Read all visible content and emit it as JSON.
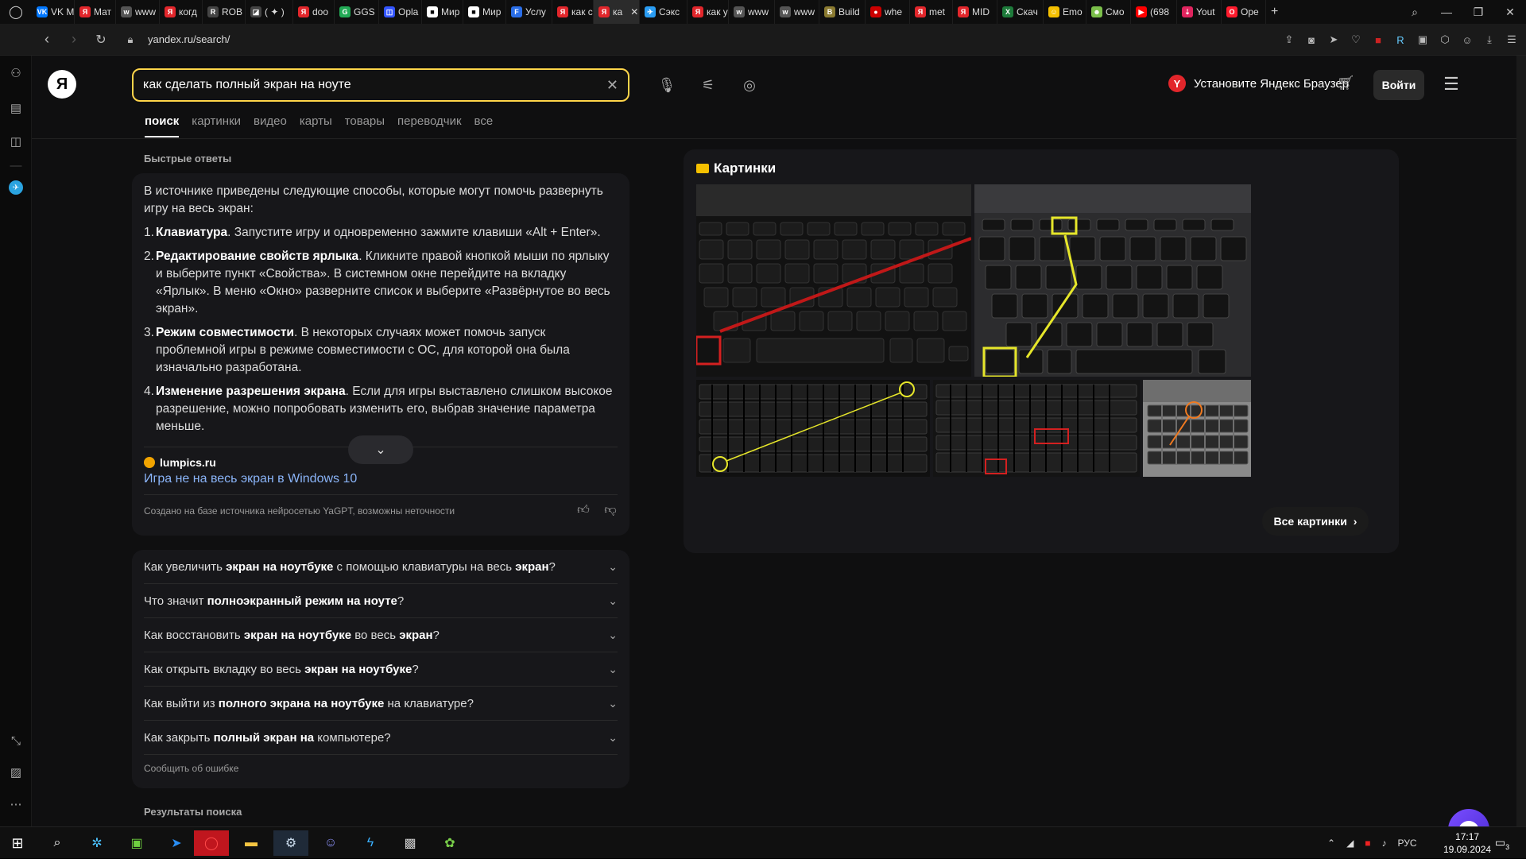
{
  "browser": {
    "tabs": [
      {
        "label": "VK M",
        "color": "#0077ff",
        "glyph": "VK"
      },
      {
        "label": "Мат",
        "color": "#e2262b",
        "glyph": "Я"
      },
      {
        "label": "www",
        "color": "#555555",
        "glyph": "w"
      },
      {
        "label": "когд",
        "color": "#e2262b",
        "glyph": "Я"
      },
      {
        "label": "ROB",
        "color": "#444444",
        "glyph": "R"
      },
      {
        "label": "( ✦ )",
        "color": "#444444",
        "glyph": "◪"
      },
      {
        "label": "doo",
        "color": "#e2262b",
        "glyph": "Я"
      },
      {
        "label": "GGS",
        "color": "#22aa55",
        "glyph": "G"
      },
      {
        "label": "Opla",
        "color": "#3355ff",
        "glyph": "◫"
      },
      {
        "label": "Мир",
        "color": "#ffffff",
        "glyph": "■"
      },
      {
        "label": "Мир",
        "color": "#ffffff",
        "glyph": "■"
      },
      {
        "label": "Услу",
        "color": "#2a6ee8",
        "glyph": "F"
      },
      {
        "label": "как с",
        "color": "#e2262b",
        "glyph": "Я"
      },
      {
        "label": "ка",
        "color": "#e2262b",
        "glyph": "Я",
        "active": true
      },
      {
        "label": "Сэкс",
        "color": "#2a9df4",
        "glyph": "✈"
      },
      {
        "label": "как у",
        "color": "#e2262b",
        "glyph": "Я"
      },
      {
        "label": "www",
        "color": "#555555",
        "glyph": "w"
      },
      {
        "label": "www",
        "color": "#555555",
        "glyph": "w"
      },
      {
        "label": "Build",
        "color": "#8a7a30",
        "glyph": "B"
      },
      {
        "label": "whe",
        "color": "#cc0000",
        "glyph": "●"
      },
      {
        "label": "met",
        "color": "#e2262b",
        "glyph": "Я"
      },
      {
        "label": "MID",
        "color": "#e2262b",
        "glyph": "Я"
      },
      {
        "label": "Скач",
        "color": "#1d7a3a",
        "glyph": "X"
      },
      {
        "label": "Emo",
        "color": "#f5c000",
        "glyph": "☺"
      },
      {
        "label": "Смо",
        "color": "#7bbf4a",
        "glyph": "☻"
      },
      {
        "label": "(698",
        "color": "#ff0000",
        "glyph": "▶"
      },
      {
        "label": "Yout",
        "color": "#e0245e",
        "glyph": "⇣"
      },
      {
        "label": "Ope",
        "color": "#ff1b2d",
        "glyph": "O"
      }
    ],
    "url": "yandex.ru/search/"
  },
  "header": {
    "logo": "Я",
    "search_value": "как сделать полный экран на ноуте",
    "install_badge": "Y",
    "install_label": "Установите Яндекс Браузер",
    "login_label": "Войти"
  },
  "services": [
    {
      "label": "поиск",
      "active": true
    },
    {
      "label": "картинки"
    },
    {
      "label": "видео"
    },
    {
      "label": "карты"
    },
    {
      "label": "товары"
    },
    {
      "label": "переводчик"
    },
    {
      "label": "все"
    }
  ],
  "quick_answers": {
    "title": "Быстрые ответы",
    "intro": "В источнике приведены следующие способы, которые могут помочь развернуть игру на весь экран:",
    "items": [
      {
        "n": "1.",
        "bold": "Клавиатура",
        "text": ". Запустите игру и одновременно зажмите клавиши «Alt + Enter»."
      },
      {
        "n": "2.",
        "bold": "Редактирование свойств ярлыка",
        "text": ". Кликните правой кнопкой мыши по ярлыку и выберите пункт «Свойства». В системном окне перейдите на вкладку «Ярлык». В меню «Окно» разверните список и выберите «Развёрнутое во весь экран»."
      },
      {
        "n": "3.",
        "bold": "Режим совместимости",
        "text": ". В некоторых случаях может помочь запуск проблемной игры в режиме совместимости с ОС, для которой она была изначально разработана."
      },
      {
        "n": "4.",
        "bold": "Изменение разрешения экрана",
        "text": ". Если для игры выставлено слишком высокое разрешение, можно попробовать изменить его, выбрав значение параметра меньше."
      }
    ],
    "source_site": "lumpics.ru",
    "source_link": "Игра не на весь экран в Windows 10",
    "ai_note": "Создано на базе источника нейросетью YaGPT, возможны неточности"
  },
  "faq": {
    "items": [
      {
        "pre": "Как увеличить ",
        "b1": "экран на ноутбуке",
        "mid": " с помощью клавиатуры на весь ",
        "b2": "экран",
        "post": "?"
      },
      {
        "pre": "Что значит ",
        "b1": "полноэкранный режим на ноуте",
        "mid": "",
        "b2": "",
        "post": "?"
      },
      {
        "pre": "Как восстановить ",
        "b1": "экран на ноутбуке",
        "mid": " во весь ",
        "b2": "экран",
        "post": "?"
      },
      {
        "pre": "Как открыть вкладку во весь ",
        "b1": "экран на ноутбуке",
        "mid": "",
        "b2": "",
        "post": "?"
      },
      {
        "pre": "Как выйти из ",
        "b1": "полного экрана на ноутбуке",
        "mid": " на клавиатуре",
        "b2": "",
        "post": "?"
      },
      {
        "pre": "Как закрыть ",
        "b1": "полный экран на",
        "mid": " компьютере",
        "b2": "",
        "post": "?"
      }
    ],
    "report": "Сообщить об ошибке"
  },
  "results_title": "Результаты поиска",
  "images": {
    "title": "Картинки",
    "all_label": "Все картинки"
  },
  "taskbar": {
    "lang": "РУС",
    "time": "17:17",
    "date": "19.09.2024",
    "notif_count": "3"
  }
}
